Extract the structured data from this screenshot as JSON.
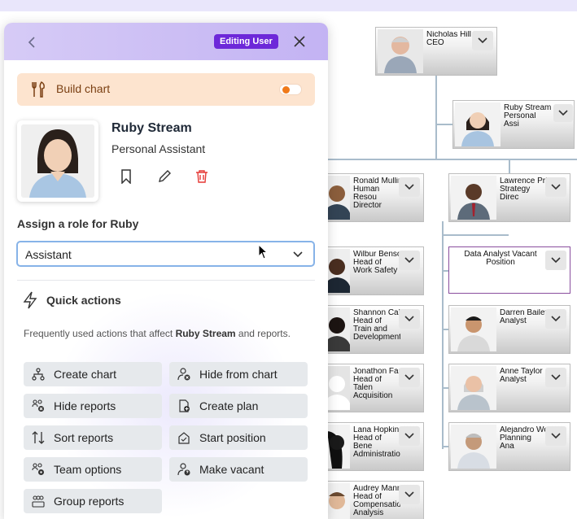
{
  "panel": {
    "badge": "Editing User",
    "build_chart_label": "Build chart",
    "user_name": "Ruby Stream",
    "user_title": "Personal Assistant",
    "role_label": "Assign a role for Ruby",
    "role_value": "Assistant",
    "quick_actions_title": "Quick actions",
    "quick_actions_desc_prefix": "Frequently used actions that affect ",
    "quick_actions_desc_name": "Ruby Stream",
    "quick_actions_desc_suffix": " and reports.",
    "actions": [
      {
        "label": "Create chart",
        "icon": "hierarchy-icon"
      },
      {
        "label": "Hide from chart",
        "icon": "user-hide-icon"
      },
      {
        "label": "Hide reports",
        "icon": "group-hide-icon"
      },
      {
        "label": "Create plan",
        "icon": "plan-icon"
      },
      {
        "label": "Sort reports",
        "icon": "sort-icon"
      },
      {
        "label": "Start position",
        "icon": "start-position-icon"
      },
      {
        "label": "Team options",
        "icon": "team-options-icon"
      },
      {
        "label": "Make vacant",
        "icon": "make-vacant-icon"
      },
      {
        "label": "Group reports",
        "icon": "group-reports-icon"
      }
    ],
    "colors": {
      "accent": "#6d28d9",
      "delete": "#e53935",
      "build_bg": "#fde4cf"
    }
  },
  "chart": {
    "cards": [
      {
        "name": "Nicholas Hill",
        "title": "CEO"
      },
      {
        "name": "Ruby Stream",
        "title": "Personal Assi"
      },
      {
        "name": "Ronald Mullin",
        "title": "Human Resou Director"
      },
      {
        "name": "Lawrence Pric",
        "title": "Strategy Direc"
      },
      {
        "name": "Wilbur Benso",
        "title": "Head of Work Safety"
      },
      {
        "name": "",
        "title": "Data Analyst Vacant Position"
      },
      {
        "name": "Shannon Calc",
        "title": "Head of Train and Development"
      },
      {
        "name": "Darren Bailey",
        "title": "Analyst"
      },
      {
        "name": "Jonathon Far",
        "title": "Head of Talen Acquisition"
      },
      {
        "name": "Anne Taylor",
        "title": "Analyst"
      },
      {
        "name": "Lana Hopkins",
        "title": "Head of Bene Administration"
      },
      {
        "name": "Alejandro We",
        "title": "Planning Ana"
      },
      {
        "name": "Audrey Mann",
        "title": "Head of Compensation Analysis"
      }
    ]
  }
}
